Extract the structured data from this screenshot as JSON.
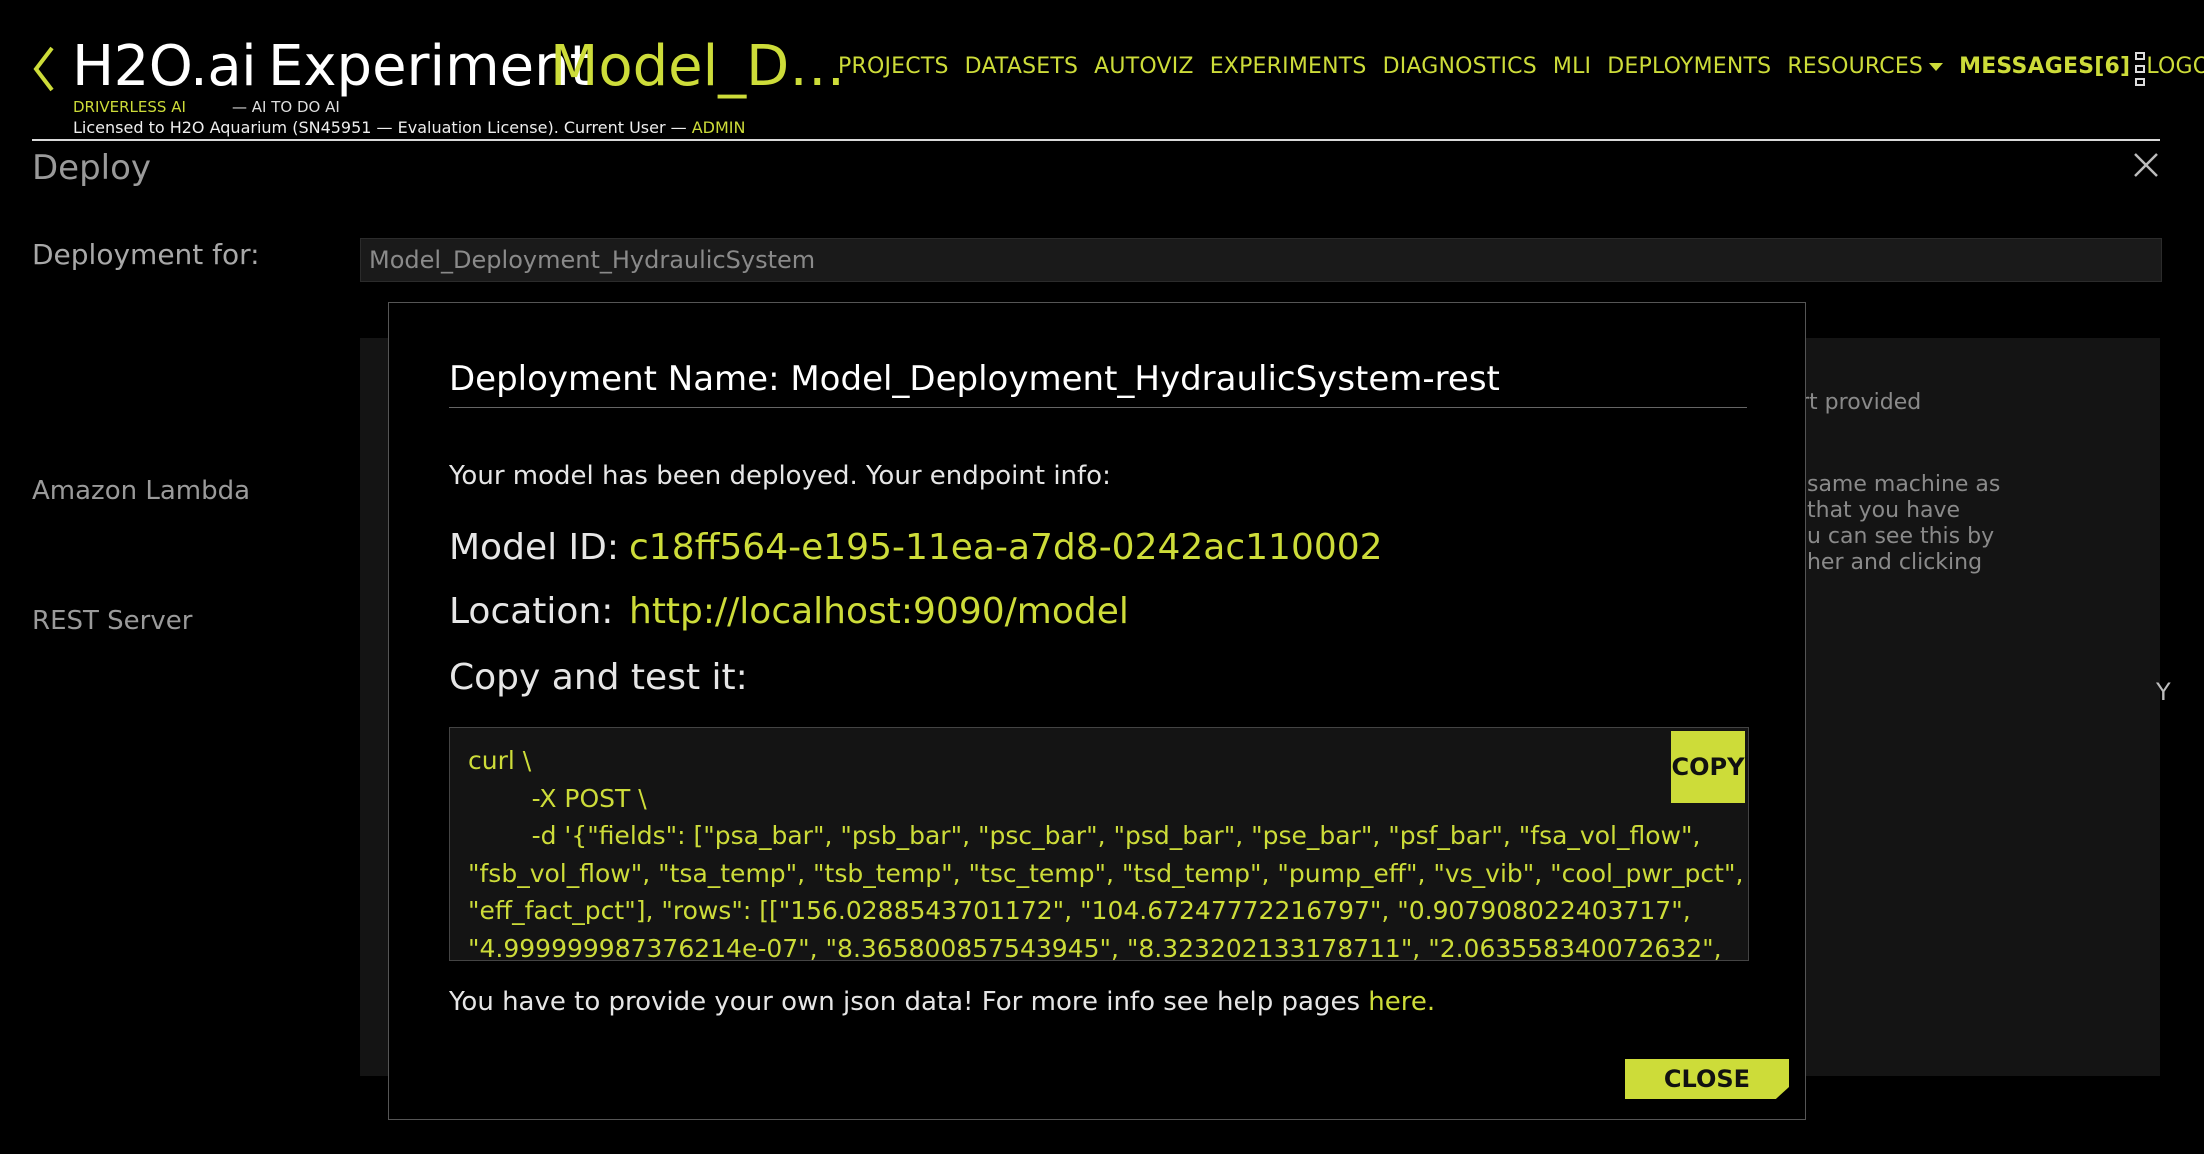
{
  "header": {
    "brand": "H2O.ai",
    "experiment_label": "Experiment",
    "experiment_name": "Model_Deployment_HydraulicSystem",
    "tagline_product": "DRIVERLESS AI",
    "tagline_motto": "— AI TO DO AI",
    "license_text": "Licensed to H2O Aquarium (SN45951 — Evaluation License). Current User —",
    "current_user": "ADMIN",
    "nav": {
      "projects": "PROJECTS",
      "datasets": "DATASETS",
      "autoviz": "AUTOVIZ",
      "experiments": "EXPERIMENTS",
      "diagnostics": "DIAGNOSTICS",
      "mli": "MLI",
      "deployments": "DEPLOYMENTS",
      "resources": "RESOURCES",
      "messages": "MESSAGES[6]",
      "logout": "LOGOUT"
    }
  },
  "deploy": {
    "title": "Deploy",
    "deployment_for_label": "Deployment for:",
    "deployment_for_value": "Model_Deployment_HydraulicSystem",
    "options": {
      "lambda": "Amazon Lambda",
      "rest": "REST Server"
    },
    "bg_text_1": "rt provided",
    "bg_text_2": " same machine as\n that you have\n u can see this by\n her and clicking",
    "bg_text_3": "Y"
  },
  "modal": {
    "title": "Deployment Name: Model_Deployment_HydraulicSystem-rest",
    "intro": "Your model has been deployed. Your endpoint info:",
    "model_id_label": "Model ID:",
    "model_id": "c18ff564-e195-11ea-a7d8-0242ac110002",
    "location_label": "Location:",
    "location": "http://localhost:9090/model",
    "copy_test_label": "Copy and test it:",
    "code": "curl \\\n        -X POST \\\n        -d '{\"fields\": [\"psa_bar\", \"psb_bar\", \"psc_bar\", \"psd_bar\", \"pse_bar\", \"psf_bar\", \"fsa_vol_flow\",\n\"fsb_vol_flow\", \"tsa_temp\", \"tsb_temp\", \"tsc_temp\", \"tsd_temp\", \"pump_eff\", \"vs_vib\", \"cool_pwr_pct\",\n\"eff_fact_pct\"], \"rows\": [[\"156.0288543701172\", \"104.67247772216797\", \"0.907908022403717\",\n\"4.999999987376214e-07\", \"8.365800857543945\", \"8.323202133178711\", \"2.063558340072632\",",
    "copy_button": "COPY",
    "footnote": "You have to provide your own json data! For more info see help pages",
    "footnote_link": "here.",
    "close_button": "CLOSE"
  },
  "colors": {
    "accent": "#cddc39",
    "background": "#000000",
    "panel": "#141414"
  },
  "icons": {
    "back": "chevron-left-icon",
    "menu": "kebab-menu-icon",
    "close": "close-icon",
    "dropdown": "caret-down-icon"
  }
}
